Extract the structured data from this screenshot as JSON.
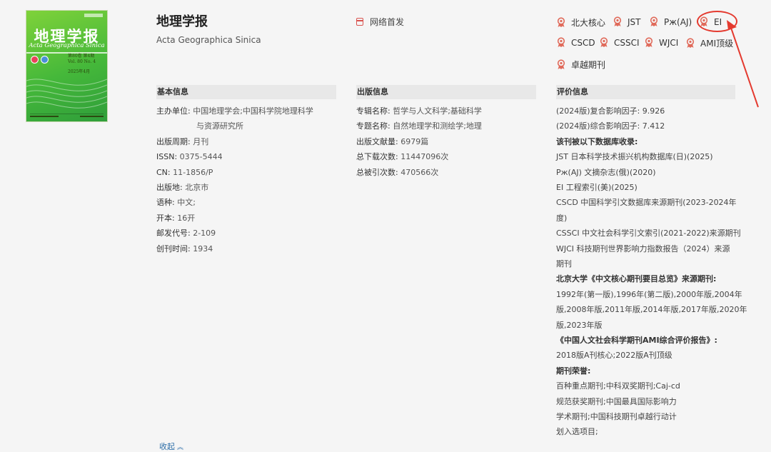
{
  "cover": {
    "title": "地理学报",
    "subtitle": "Acta Geographica Sinica",
    "issue_line1": "第80卷 第4期",
    "issue_line2": "Vol. 80   No. 4",
    "date": "2025年4月"
  },
  "journal": {
    "title": "地理学报",
    "english_title": "Acta Geographica Sinica"
  },
  "first_publication": {
    "label": "网络首发",
    "icon": "calendar-icon"
  },
  "badges": [
    "北大核心",
    "JST",
    "Pж(AJ)",
    "EI",
    "CSCD",
    "CSSCI",
    "WJCI",
    "AMI顶级",
    "卓越期刊"
  ],
  "badge_icon": "award-ribbon-icon",
  "highlight_color": "#e43a2f",
  "basic_info": {
    "heading": "基本信息",
    "rows": [
      {
        "label": "主办单位:",
        "value": "中国地理学会;中国科学院地理科学",
        "value2": "与资源研究所"
      },
      {
        "label": "出版周期:",
        "value": "月刊"
      },
      {
        "label": "ISSN:",
        "value": "0375-5444"
      },
      {
        "label": "CN:",
        "value": "11-1856/P"
      },
      {
        "label": "出版地:",
        "value": "北京市"
      },
      {
        "label": "语种:",
        "value": "中文;"
      },
      {
        "label": "开本:",
        "value": "16开"
      },
      {
        "label": "邮发代号:",
        "value": "2-109"
      },
      {
        "label": "创刊时间:",
        "value": "1934"
      }
    ]
  },
  "publication_info": {
    "heading": "出版信息",
    "rows": [
      {
        "label": "专辑名称:",
        "value": "哲学与人文科学;基础科学"
      },
      {
        "label": "专题名称:",
        "value": "自然地理学和测绘学;地理"
      },
      {
        "label": "出版文献量:",
        "value": "6979篇"
      },
      {
        "label": "总下载次数:",
        "value": "11447096次"
      },
      {
        "label": "总被引次数:",
        "value": "470566次"
      }
    ]
  },
  "evaluation_info": {
    "heading": "评价信息",
    "lines": [
      "(2024版)复合影响因子: 9.926",
      "(2024版)综合影响因子: 7.412",
      "该刊被以下数据库收录:",
      "JST 日本科学技术振兴机构数据库(日)(2025)",
      "Pж(AJ) 文摘杂志(俄)(2020)",
      "EI 工程索引(美)(2025)",
      "CSCD 中国科学引文数据库来源期刊(2023-2024年",
      "度)",
      "CSSCI 中文社会科学引文索引(2021-2022)来源期刊",
      "WJCI 科技期刊世界影响力指数报告（2024）来源",
      "期刊",
      "北京大学《中文核心期刊要目总览》来源期刊:",
      "1992年(第一版),1996年(第二版),2000年版,2004年",
      "版,2008年版,2011年版,2014年版,2017年版,2020年",
      "版,2023年版",
      "《中国人文社会科学期刊AMI综合评价报告》:",
      "2018版A刊核心;2022版A刊顶级",
      "期刊荣誉:",
      "百种重点期刊;中科双奖期刊;Caj-cd",
      "规范获奖期刊;中国最具国际影响力",
      "学术期刊;中国科技期刊卓越行动计",
      "划入选项目;"
    ]
  },
  "collapse_label": "收起"
}
